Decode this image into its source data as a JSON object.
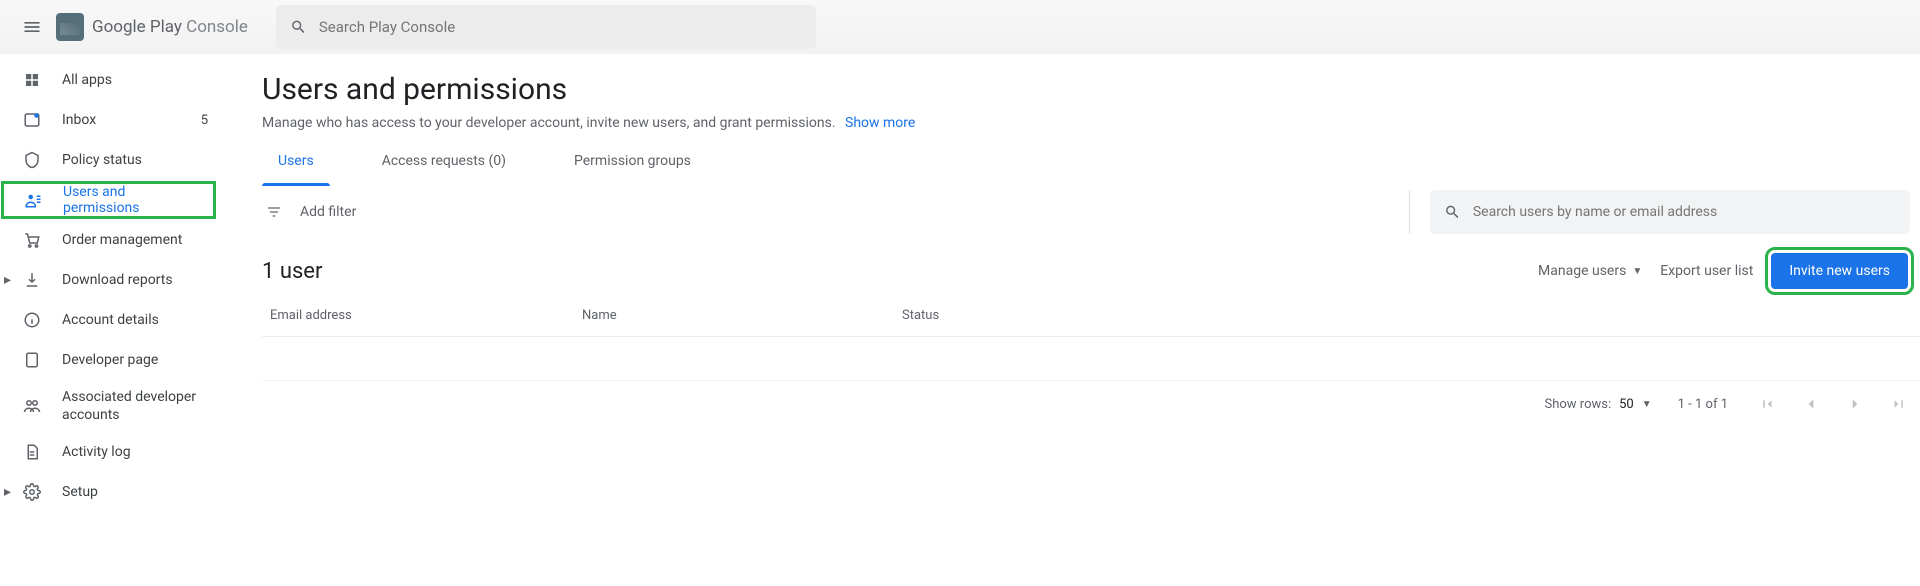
{
  "header": {
    "brand_1": "Google Play ",
    "brand_2": "Console",
    "search_placeholder": "Search Play Console"
  },
  "sidebar": {
    "items": [
      {
        "label": "All apps"
      },
      {
        "label": "Inbox",
        "badge": "5"
      },
      {
        "label": "Policy status"
      },
      {
        "label": "Users and permissions"
      },
      {
        "label": "Order management"
      },
      {
        "label": "Download reports"
      },
      {
        "label": "Account details"
      },
      {
        "label": "Developer page"
      },
      {
        "label": "Associated developer accounts"
      },
      {
        "label": "Activity log"
      },
      {
        "label": "Setup"
      }
    ]
  },
  "page": {
    "title": "Users and permissions",
    "subtitle": "Manage who has access to your developer account, invite new users, and grant permissions.",
    "show_more": "Show more"
  },
  "tabs": {
    "users": "Users",
    "access": "Access requests (0)",
    "groups": "Permission groups"
  },
  "filter": {
    "add_filter": "Add filter",
    "user_search_placeholder": "Search users by name or email address"
  },
  "list": {
    "heading": "1 user",
    "manage": "Manage users",
    "export": "Export user list",
    "invite": "Invite new users",
    "col_email": "Email address",
    "col_name": "Name",
    "col_status": "Status"
  },
  "footer": {
    "show_rows": "Show rows:",
    "rows_value": "50",
    "range": "1 - 1 of 1"
  }
}
